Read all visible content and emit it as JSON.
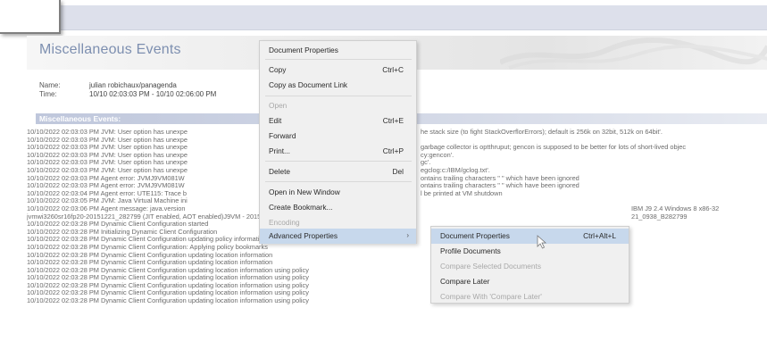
{
  "page": {
    "title": "Miscellaneous Events",
    "name_label": "Name:",
    "name_value": "julian robichaux/panagenda",
    "time_label": "Time:",
    "time_value": "10/10 02:03:03 PM - 10/10 02:06:00 PM",
    "section_title": "Miscellaneous Events:"
  },
  "log_lines": [
    "10/10/2022 02:03:03 PM  JVM: User option has unexpe",
    "10/10/2022 02:03:03 PM  JVM: User option has unexpe",
    "10/10/2022 02:03:03 PM  JVM: User option has unexpe",
    "10/10/2022 02:03:03 PM  JVM: User option has unexpe",
    "10/10/2022 02:03:03 PM  JVM: User option has unexpe",
    "10/10/2022 02:03:03 PM  JVM: User option has unexpe",
    "10/10/2022 02:03:03 PM  Agent  error: JVMJ9VM081W",
    "10/10/2022 02:03:03 PM  Agent  error: JVMJ9VM081W",
    "10/10/2022 02:03:04 PM  Agent  error: UTE115: Trace b",
    "10/10/2022 02:03:05 PM  JVM: Java Virtual Machine ini",
    "10/10/2022 02:03:06 PM  Agent message: java.version",
    "jvmwi3260sr16fp20-20151221_282799 (JIT enabled, AOT enabled)J9VM - 20151221_282799JIT -",
    "10/10/2022 02:03:28 PM  Dynamic Client Configuration started",
    "10/10/2022 02:03:28 PM  Initializing Dynamic Client Configuration",
    "10/10/2022 02:03:28 PM  Dynamic Client Configuration updating policy information",
    "10/10/2022 02:03:28 PM  Dynamic Client Configuration: Applying policy bookmarks",
    "10/10/2022 02:03:28 PM  Dynamic Client Configuration updating location information",
    "10/10/2022 02:03:28 PM  Dynamic Client Configuration updating location information",
    "10/10/2022 02:03:28 PM  Dynamic Client Configuration updating location information using policy",
    "10/10/2022 02:03:28 PM  Dynamic Client Configuration updating location information using policy",
    "10/10/2022 02:03:28 PM  Dynamic Client Configuration updating location information using policy",
    "10/10/2022 02:03:28 PM  Dynamic Client Configuration updating location information using policy",
    "10/10/2022 02:03:28 PM  Dynamic Client Configuration updating location information using policy"
  ],
  "right_fragments": [
    "he stack size (to fight StackOverflorErrors); default is 256k on 32bit, 512k on 64bit'.",
    "garbage collector is optthruput; gencon is supposed to be better for lots of short-lived objec",
    "cy:gencon'.",
    "gc'.",
    "egclog:c:/IBM/gclog.txt'.",
    "ontains trailing characters \" \" which have been ignored",
    "ontains trailing characters \" \" which have been ignored",
    "l be printed at VM shutdown",
    "IBM J9 2.4 Windows 8 x86-32",
    "21_0938_B282799"
  ],
  "context_menu": {
    "items": [
      {
        "label": "Document Properties",
        "shortcut": ""
      },
      {
        "label": "Copy",
        "shortcut": "Ctrl+C"
      },
      {
        "label": "Copy as Document Link",
        "shortcut": ""
      },
      {
        "label": "Open",
        "shortcut": ""
      },
      {
        "label": "Edit",
        "shortcut": "Ctrl+E"
      },
      {
        "label": "Forward",
        "shortcut": ""
      },
      {
        "label": "Print...",
        "shortcut": "Ctrl+P"
      },
      {
        "label": "Delete",
        "shortcut": "Del"
      },
      {
        "label": "Open in New Window",
        "shortcut": ""
      },
      {
        "label": "Create Bookmark...",
        "shortcut": ""
      },
      {
        "label": "Encoding",
        "shortcut": ""
      },
      {
        "label": "Advanced Properties",
        "shortcut": ""
      }
    ]
  },
  "submenu": {
    "items": [
      {
        "label": "Document Properties",
        "shortcut": "Ctrl+Alt+L"
      },
      {
        "label": "Profile Documents",
        "shortcut": ""
      },
      {
        "label": "Compare Selected Documents",
        "shortcut": ""
      },
      {
        "label": "Compare Later",
        "shortcut": ""
      },
      {
        "label": "Compare With 'Compare Later'",
        "shortcut": ""
      }
    ]
  },
  "colors": {
    "menu_bg": "#f0f0f0",
    "menu_highlight": "#c7d8ec",
    "title_text": "#7d8fb0",
    "section_bar": "#bfc7dc"
  },
  "icons": {
    "submenu_arrow": "chevron-right-icon",
    "pointer": "mouse-pointer-icon"
  }
}
